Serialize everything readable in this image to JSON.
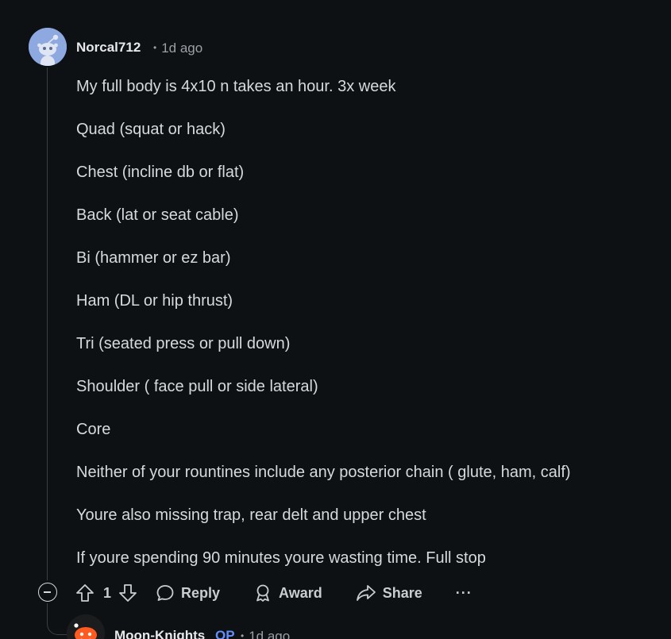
{
  "comment": {
    "author": "Norcal712",
    "separator": "•",
    "time": "1d ago",
    "paragraphs": [
      "My full body is 4x10 n takes an hour. 3x week",
      "Quad (squat or hack)",
      "Chest (incline db or flat)",
      "Back (lat or seat cable)",
      "Bi (hammer or ez bar)",
      "Ham (DL or hip thrust)",
      "Tri (seated press or pull down)",
      "Shoulder ( face pull or side lateral)",
      "Core",
      "Neither of your rountines include any posterior chain ( glute, ham, calf)",
      "Youre also missing trap, rear delt and upper chest",
      "If youre spending 90 minutes youre wasting time. Full stop"
    ],
    "actions": {
      "vote_count": "1",
      "reply_label": "Reply",
      "award_label": "Award",
      "share_label": "Share",
      "more_label": "···"
    }
  },
  "reply_comment": {
    "author": "Moon-Knights",
    "op_badge": "OP",
    "separator": "•",
    "time": "1d ago"
  },
  "colors": {
    "background": "#0e1113",
    "text": "#d7dadc",
    "muted": "#9aa0a6",
    "op_accent": "#648efc",
    "avatar_bg": "#8ea8e0"
  },
  "icons": {
    "avatar": "reddit-snoo-avatar",
    "collapse": "collapse-minus-icon",
    "upvote": "upvote-arrow-icon",
    "downvote": "downvote-arrow-icon",
    "reply": "speech-bubble-icon",
    "award": "award-ribbon-icon",
    "share": "share-arrow-icon"
  }
}
